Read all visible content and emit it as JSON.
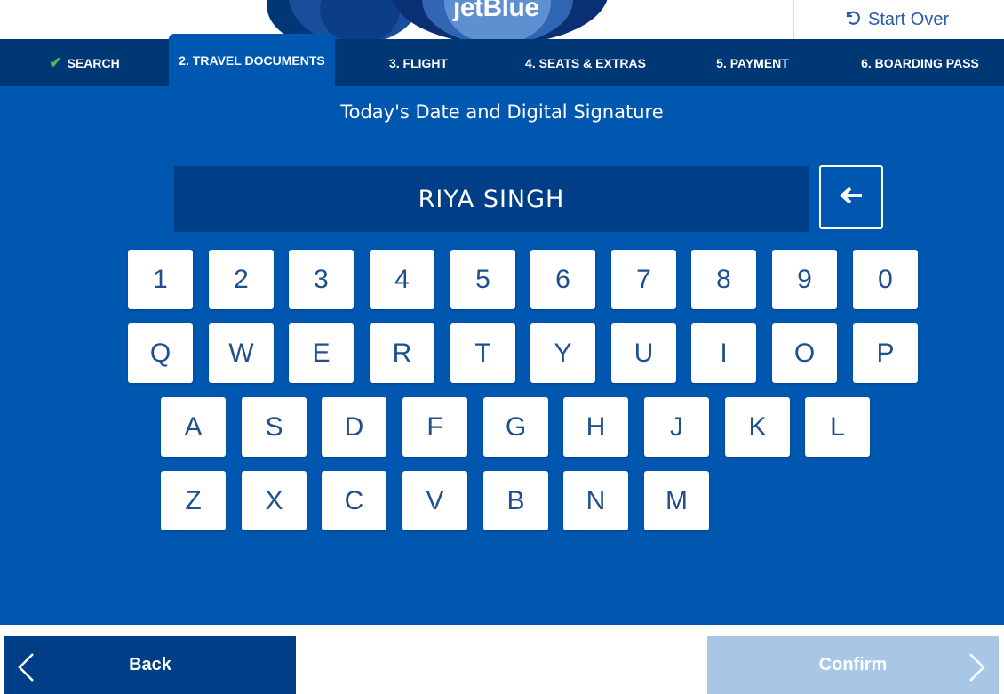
{
  "header": {
    "logo_text": "jetBlue",
    "start_over_label": "Start Over"
  },
  "steps": [
    {
      "label": "SEARCH",
      "state": "done"
    },
    {
      "label": "2. TRAVEL DOCUMENTS",
      "state": "active"
    },
    {
      "label": "3. FLIGHT",
      "state": "pending"
    },
    {
      "label": "4. SEATS & EXTRAS",
      "state": "pending"
    },
    {
      "label": "5. PAYMENT",
      "state": "pending"
    },
    {
      "label": "6. BOARDING PASS",
      "state": "pending"
    }
  ],
  "main": {
    "title": "Today's Date and Digital Signature",
    "name_value": "RIYA SINGH"
  },
  "keyboard": {
    "row1": [
      "1",
      "2",
      "3",
      "4",
      "5",
      "6",
      "7",
      "8",
      "9",
      "0"
    ],
    "row2": [
      "Q",
      "W",
      "E",
      "R",
      "T",
      "Y",
      "U",
      "I",
      "O",
      "P"
    ],
    "row3": [
      "A",
      "S",
      "D",
      "F",
      "G",
      "H",
      "J",
      "K",
      "L"
    ],
    "row4": [
      "Z",
      "X",
      "C",
      "V",
      "B",
      "N",
      "M"
    ]
  },
  "footer": {
    "back_label": "Back",
    "confirm_label": "Confirm",
    "confirm_enabled": false
  },
  "colors": {
    "primary_blue": "#0057b0",
    "nav_dark": "#003876",
    "field_dark": "#003f88",
    "check_green": "#4dc04d",
    "confirm_disabled": "#a8c6e6"
  },
  "icons": {
    "start_over": "undo-icon",
    "step_done": "check-icon",
    "backspace": "arrow-left-icon",
    "back": "chevron-left-icon",
    "confirm": "chevron-right-icon"
  }
}
